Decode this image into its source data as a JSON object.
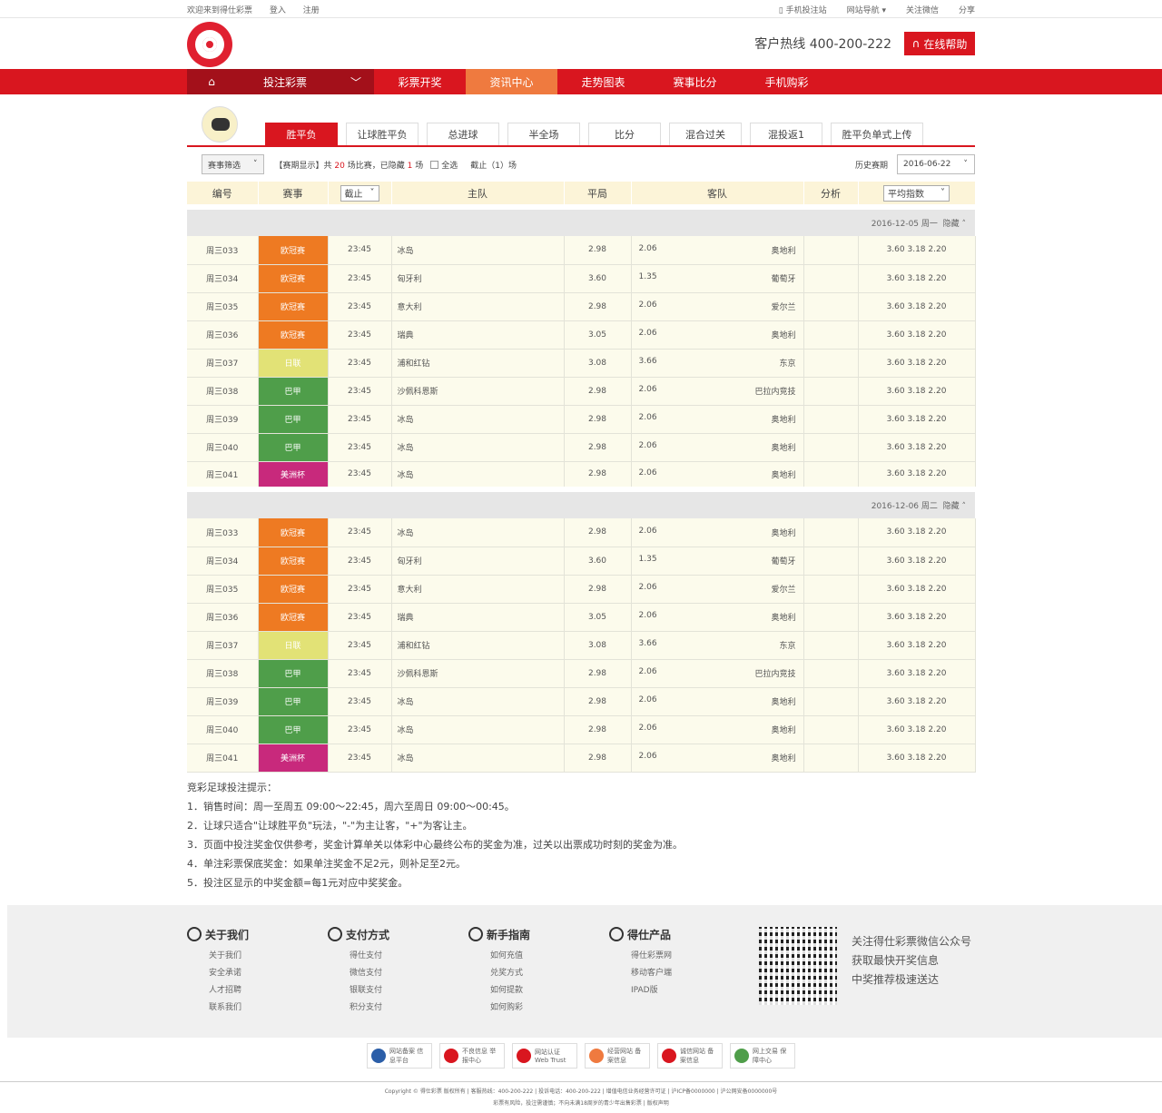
{
  "topbar": {
    "welcome": "欢迎来到得仕彩票",
    "login": "登入",
    "register": "注册",
    "mobile_site": "手机投注站",
    "site_nav": "网站导航 ▾",
    "follow_wechat": "关注微信",
    "share": "分享"
  },
  "header": {
    "hotline": "客户热线 400-200-222",
    "online_help": "在线帮助"
  },
  "nav": {
    "bet_label": "投注彩票",
    "items": [
      "彩票开奖",
      "资讯中心",
      "走势图表",
      "赛事比分",
      "手机购彩"
    ]
  },
  "subtabs": [
    "胜平负",
    "让球胜平负",
    "总进球",
    "半全场",
    "比分",
    "混合过关",
    "混投返1",
    "胜平负单式上传"
  ],
  "filters": {
    "league_select": "赛事筛选",
    "notice_prefix": "【赛期显示】共",
    "total": "20",
    "notice_mid": "场比赛，已隐藏",
    "hidden": "1",
    "notice_suffix": "场",
    "select_all": "全选",
    "deadline": "截止（1）场",
    "history_label": "历史赛期",
    "date": "2016-06-22"
  },
  "table": {
    "headers": [
      "编号",
      "赛事",
      "截止",
      "主队",
      "平局",
      "客队",
      "分析",
      "平均指数"
    ],
    "groups": [
      {
        "date_label": "2016-12-05  周一",
        "hide": "隐藏 ˄",
        "rows": [
          {
            "id": "周三033",
            "league": "欧冠赛",
            "color": "#ee7a22",
            "time": "23:45",
            "home": "冰岛",
            "draw": "2.98",
            "away_odds": "2.06",
            "away": "奥地利",
            "odds": "3.60  3.18  2.20"
          },
          {
            "id": "周三034",
            "league": "欧冠赛",
            "color": "#ee7a22",
            "time": "23:45",
            "home": "匈牙利",
            "draw": "3.60",
            "away_odds": "1.35",
            "away": "葡萄牙",
            "odds": "3.60  3.18  2.20"
          },
          {
            "id": "周三035",
            "league": "欧冠赛",
            "color": "#ee7a22",
            "time": "23:45",
            "home": "意大利",
            "draw": "2.98",
            "away_odds": "2.06",
            "away": "爱尔兰",
            "odds": "3.60  3.18  2.20"
          },
          {
            "id": "周三036",
            "league": "欧冠赛",
            "color": "#ee7a22",
            "time": "23:45",
            "home": "瑞典",
            "draw": "3.05",
            "away_odds": "2.06",
            "away": "奥地利",
            "odds": "3.60  3.18  2.20"
          },
          {
            "id": "周三037",
            "league": "日联",
            "color": "#e2e276",
            "time": "23:45",
            "home": "浦和红钻",
            "draw": "3.08",
            "away_odds": "3.66",
            "away": "东京",
            "odds": "3.60  3.18  2.20"
          },
          {
            "id": "周三038",
            "league": "巴甲",
            "color": "#4f9e4a",
            "time": "23:45",
            "home": "沙佩科恩斯",
            "draw": "2.98",
            "away_odds": "2.06",
            "away": "巴拉内竞技",
            "odds": "3.60  3.18  2.20"
          },
          {
            "id": "周三039",
            "league": "巴甲",
            "color": "#4f9e4a",
            "time": "23:45",
            "home": "冰岛",
            "draw": "2.98",
            "away_odds": "2.06",
            "away": "奥地利",
            "odds": "3.60  3.18  2.20"
          },
          {
            "id": "周三040",
            "league": "巴甲",
            "color": "#4f9e4a",
            "time": "23:45",
            "home": "冰岛",
            "draw": "2.98",
            "away_odds": "2.06",
            "away": "奥地利",
            "odds": "3.60  3.18  2.20"
          },
          {
            "id": "周三041",
            "league": "美洲杯",
            "color": "#c8297c",
            "time": "23:45",
            "home": "冰岛",
            "draw": "2.98",
            "away_odds": "2.06",
            "away": "奥地利",
            "odds": "3.60  3.18  2.20"
          }
        ]
      },
      {
        "date_label": "2016-12-06  周二",
        "hide": "隐藏 ˄",
        "rows": [
          {
            "id": "周三033",
            "league": "欧冠赛",
            "color": "#ee7a22",
            "time": "23:45",
            "home": "冰岛",
            "draw": "2.98",
            "away_odds": "2.06",
            "away": "奥地利",
            "odds": "3.60  3.18  2.20"
          },
          {
            "id": "周三034",
            "league": "欧冠赛",
            "color": "#ee7a22",
            "time": "23:45",
            "home": "匈牙利",
            "draw": "3.60",
            "away_odds": "1.35",
            "away": "葡萄牙",
            "odds": "3.60  3.18  2.20"
          },
          {
            "id": "周三035",
            "league": "欧冠赛",
            "color": "#ee7a22",
            "time": "23:45",
            "home": "意大利",
            "draw": "2.98",
            "away_odds": "2.06",
            "away": "爱尔兰",
            "odds": "3.60  3.18  2.20"
          },
          {
            "id": "周三036",
            "league": "欧冠赛",
            "color": "#ee7a22",
            "time": "23:45",
            "home": "瑞典",
            "draw": "3.05",
            "away_odds": "2.06",
            "away": "奥地利",
            "odds": "3.60  3.18  2.20"
          },
          {
            "id": "周三037",
            "league": "日联",
            "color": "#e2e276",
            "time": "23:45",
            "home": "浦和红钻",
            "draw": "3.08",
            "away_odds": "3.66",
            "away": "东京",
            "odds": "3.60  3.18  2.20"
          },
          {
            "id": "周三038",
            "league": "巴甲",
            "color": "#4f9e4a",
            "time": "23:45",
            "home": "沙佩科恩斯",
            "draw": "2.98",
            "away_odds": "2.06",
            "away": "巴拉内竞技",
            "odds": "3.60  3.18  2.20"
          },
          {
            "id": "周三039",
            "league": "巴甲",
            "color": "#4f9e4a",
            "time": "23:45",
            "home": "冰岛",
            "draw": "2.98",
            "away_odds": "2.06",
            "away": "奥地利",
            "odds": "3.60  3.18  2.20"
          },
          {
            "id": "周三040",
            "league": "巴甲",
            "color": "#4f9e4a",
            "time": "23:45",
            "home": "冰岛",
            "draw": "2.98",
            "away_odds": "2.06",
            "away": "奥地利",
            "odds": "3.60  3.18  2.20"
          },
          {
            "id": "周三041",
            "league": "美洲杯",
            "color": "#c8297c",
            "time": "23:45",
            "home": "冰岛",
            "draw": "2.98",
            "away_odds": "2.06",
            "away": "奥地利",
            "odds": "3.60  3.18  2.20"
          }
        ]
      }
    ]
  },
  "tips": {
    "title": "竞彩足球投注提示：",
    "items": [
      "1．销售时间：周一至周五 09:00～22:45，周六至周日 09:00～00:45。",
      "2．让球只适合\"让球胜平负\"玩法，\"-\"为主让客，\"+\"为客让主。",
      "3．页面中投注奖金仅供参考，奖金计算单关以体彩中心最终公布的奖金为准，过关以出票成功时刻的奖金为准。",
      "4．单注彩票保底奖金：如果单注奖金不足2元，则补足至2元。",
      "5．投注区显示的中奖金额=每1元对应中奖奖金。"
    ]
  },
  "footer": {
    "columns": [
      {
        "title": "关于我们",
        "icon": "user-icon",
        "links": [
          "关于我们",
          "安全承诺",
          "人才招聘",
          "联系我们"
        ]
      },
      {
        "title": "支付方式",
        "icon": "yen-icon",
        "links": [
          "得仕支付",
          "微信支付",
          "银联支付",
          "积分支付"
        ]
      },
      {
        "title": "新手指南",
        "icon": "help-icon",
        "links": [
          "如何充值",
          "兑奖方式",
          "如何提款",
          "如何购彩"
        ]
      },
      {
        "title": "得仕产品",
        "icon": "product-icon",
        "links": [
          "得仕彩票网",
          "移动客户端",
          "IPAD版"
        ]
      }
    ],
    "wechat": [
      "关注得仕彩票微信公众号",
      "获取最快开奖信息",
      "中奖推荐极速送达"
    ],
    "badges": [
      "网站备案 信息平台",
      "不良信息 举报中心",
      "网站认证 Web Trust",
      "经营网站 备案信息",
      "诚信网站 备案信息",
      "网上交易 保障中心"
    ],
    "copyright": "Copyright © 得仕彩票 版权所有 | 客服热线：400-200-222 | 投诉电话：400-200-222 | 增值电信业务经营许可证 | 沪ICP备0000000 | 沪公网安备0000000号",
    "notice": "彩票有风险，投注需谨慎；不向未满18周岁的青少年出售彩票 | 版权声明"
  }
}
